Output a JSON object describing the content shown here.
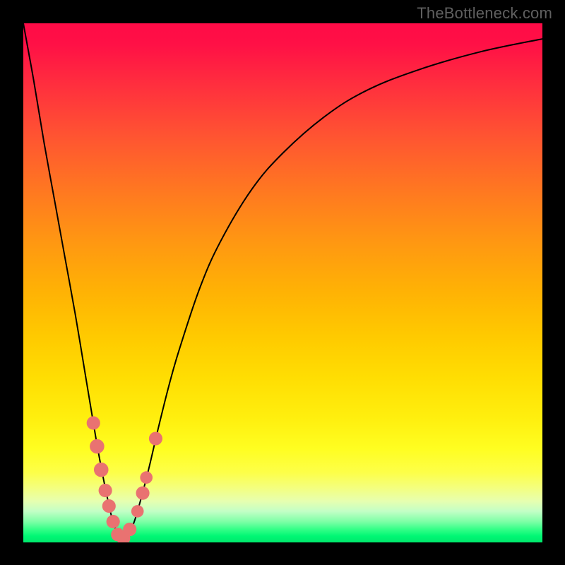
{
  "watermark": "TheBottleneck.com",
  "colors": {
    "frame": "#000000",
    "curve": "#000000",
    "marker": "#e97271",
    "gradient_top": "#ff0b47",
    "gradient_bottom": "#00e86c"
  },
  "chart_data": {
    "type": "line",
    "title": "",
    "xlabel": "",
    "ylabel": "",
    "xlim": [
      0,
      100
    ],
    "ylim": [
      0,
      100
    ],
    "grid": false,
    "legend": false,
    "series": [
      {
        "name": "bottleneck-curve",
        "x": [
          0,
          2,
          4,
          6,
          8,
          10,
          12,
          14,
          15,
          16,
          17,
          18,
          19,
          20,
          21,
          22,
          24,
          26,
          28,
          30,
          34,
          38,
          44,
          50,
          58,
          66,
          76,
          88,
          100
        ],
        "y": [
          100,
          89,
          77,
          66,
          55,
          44,
          32,
          20,
          14.5,
          9.5,
          5,
          2,
          0.5,
          1,
          3,
          6,
          13.5,
          22,
          30,
          37,
          49,
          58,
          68,
          75,
          82,
          87,
          91,
          94.5,
          97
        ]
      }
    ],
    "markers": [
      {
        "x": 13.5,
        "y": 23,
        "r": 1.3
      },
      {
        "x": 14.2,
        "y": 18.5,
        "r": 1.4
      },
      {
        "x": 15.0,
        "y": 14,
        "r": 1.4
      },
      {
        "x": 15.8,
        "y": 10,
        "r": 1.3
      },
      {
        "x": 16.5,
        "y": 7,
        "r": 1.3
      },
      {
        "x": 17.3,
        "y": 4,
        "r": 1.3
      },
      {
        "x": 18.2,
        "y": 1.5,
        "r": 1.3
      },
      {
        "x": 19.3,
        "y": 0.8,
        "r": 1.3
      },
      {
        "x": 20.5,
        "y": 2.5,
        "r": 1.3
      },
      {
        "x": 22.0,
        "y": 6,
        "r": 1.2
      },
      {
        "x": 23.0,
        "y": 9.5,
        "r": 1.3
      },
      {
        "x": 23.7,
        "y": 12.5,
        "r": 1.2
      },
      {
        "x": 25.5,
        "y": 20,
        "r": 1.3
      }
    ]
  }
}
